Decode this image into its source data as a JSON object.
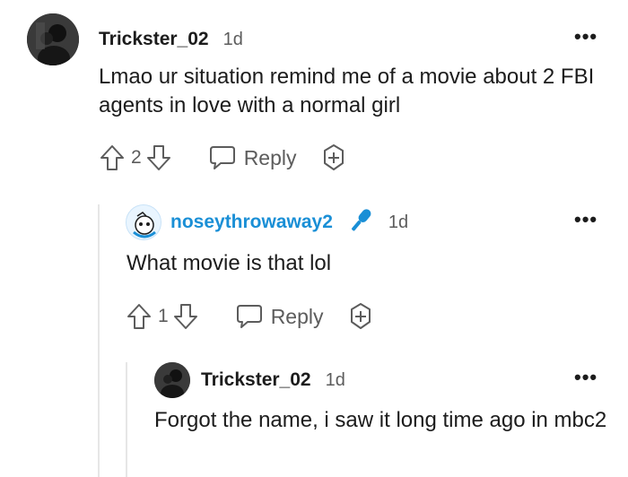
{
  "comments": [
    {
      "username": "Trickster_02",
      "time": "1d",
      "text": "Lmao ur situation remind me of a movie about 2 FBI agents in love with a normal girl",
      "votes": "2",
      "reply_label": "Reply"
    },
    {
      "username": "noseythrowaway2",
      "time": "1d",
      "text": "What movie is that lol",
      "votes": "1",
      "reply_label": "Reply"
    },
    {
      "username": "Trickster_02",
      "time": "1d",
      "text": "Forgot the name, i saw it long time ago in mbc2"
    }
  ],
  "icons": {
    "more": "more-options-icon",
    "upvote": "upvote-arrow-icon",
    "downvote": "downvote-arrow-icon",
    "reply": "reply-bubble-icon",
    "award": "award-plus-icon",
    "flair": "microphone-icon"
  },
  "colors": {
    "username_highlight": "#1a8fd6",
    "flair": "#1a8fd6",
    "muted": "#5c5c5c"
  }
}
